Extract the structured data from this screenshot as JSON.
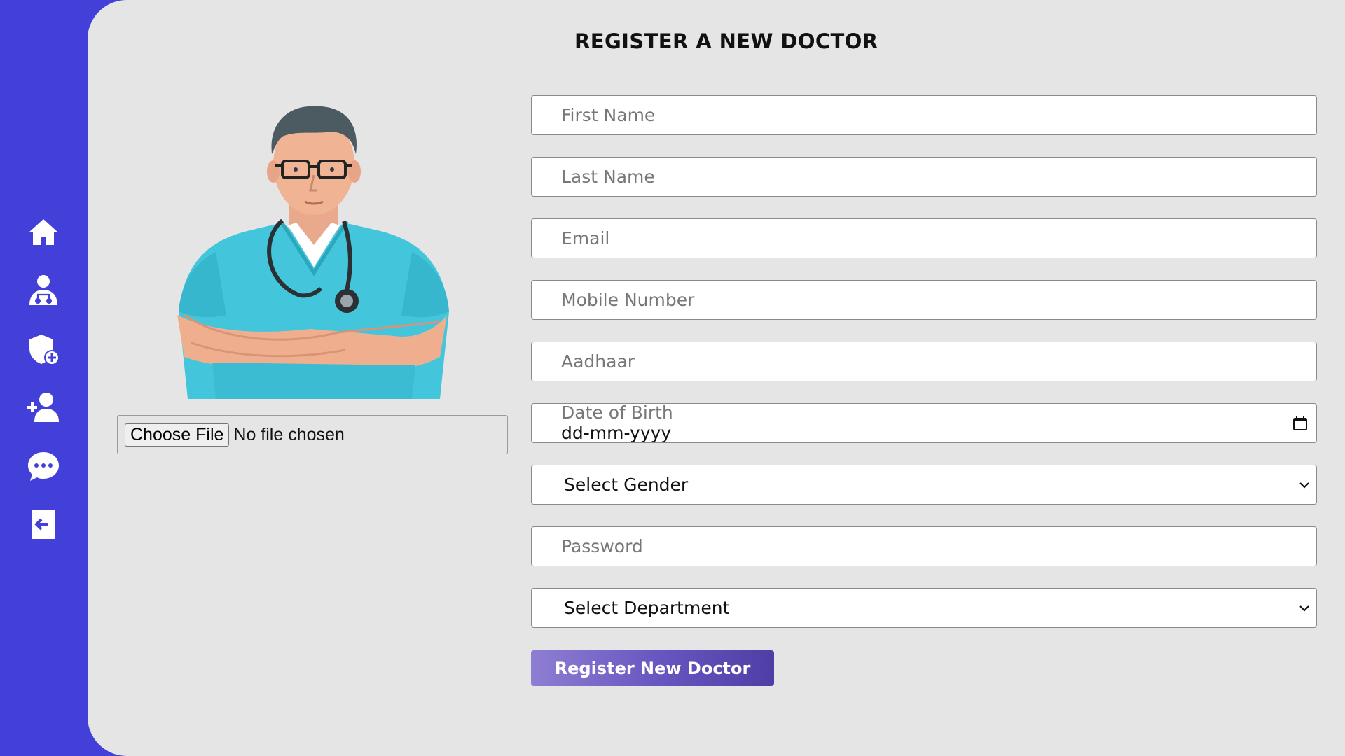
{
  "sidebar": {
    "items": [
      {
        "icon": "home-icon",
        "name": "Home"
      },
      {
        "icon": "doctor-icon",
        "name": "Doctors"
      },
      {
        "icon": "shield-plus-icon",
        "name": "Add Department"
      },
      {
        "icon": "user-plus-icon",
        "name": "Add Admin"
      },
      {
        "icon": "chat-icon",
        "name": "Messages"
      },
      {
        "icon": "logout-icon",
        "name": "Logout"
      }
    ],
    "background_color": "#4340da"
  },
  "page": {
    "title": "REGISTER A NEW DOCTOR",
    "background_color": "#e5e5e5"
  },
  "avatar": {
    "file_button_label": "Choose File",
    "file_status": "No file chosen"
  },
  "form": {
    "first_name": {
      "placeholder": "First Name",
      "value": ""
    },
    "last_name": {
      "placeholder": "Last Name",
      "value": ""
    },
    "email": {
      "placeholder": "Email",
      "value": ""
    },
    "mobile": {
      "placeholder": "Mobile Number",
      "value": ""
    },
    "aadhaar": {
      "placeholder": "Aadhaar",
      "value": ""
    },
    "dob": {
      "label": "Date of Birth",
      "value": "dd-mm-yyyy"
    },
    "gender": {
      "selected": "Select Gender"
    },
    "password": {
      "placeholder": "Password",
      "value": ""
    },
    "department": {
      "selected": "Select Department"
    },
    "submit_label": "Register New Doctor"
  }
}
